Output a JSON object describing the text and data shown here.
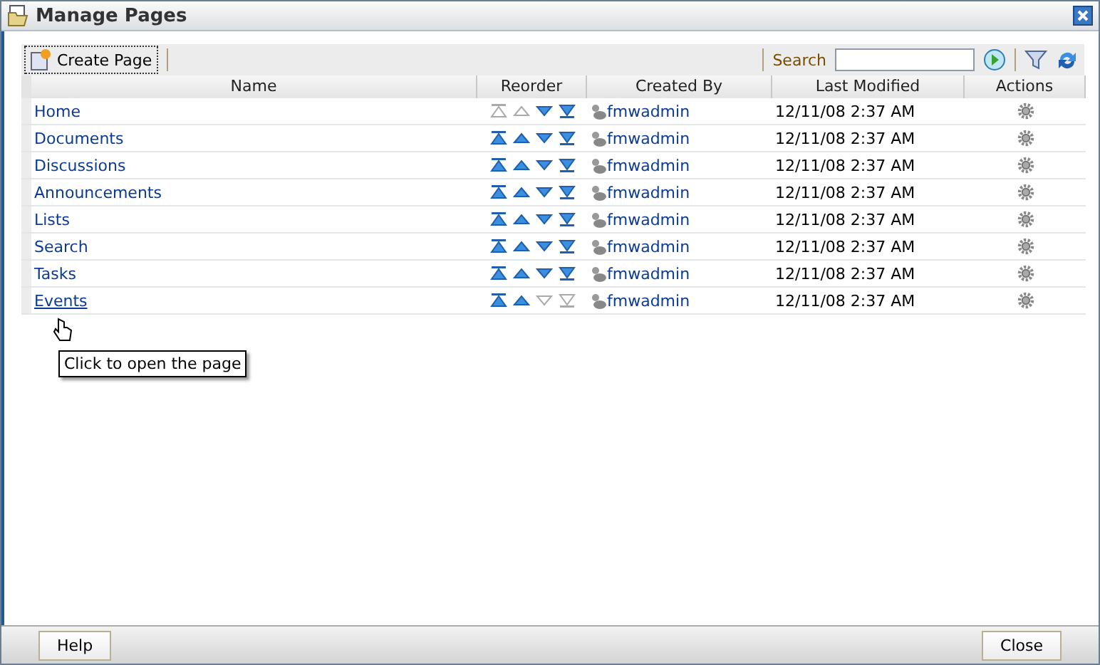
{
  "window": {
    "title": "Manage Pages"
  },
  "toolbar": {
    "create_button": "Create Page",
    "search_label": "Search"
  },
  "table": {
    "columns": [
      "Name",
      "Reorder",
      "Created By",
      "Last Modified",
      "Actions"
    ],
    "rows": [
      {
        "name": "Home",
        "can_move_up": false,
        "can_move_down": true,
        "created_by": "fmwadmin",
        "modified": "12/11/08 2:37 AM",
        "hovered": false
      },
      {
        "name": "Documents",
        "can_move_up": true,
        "can_move_down": true,
        "created_by": "fmwadmin",
        "modified": "12/11/08 2:37 AM",
        "hovered": false
      },
      {
        "name": "Discussions",
        "can_move_up": true,
        "can_move_down": true,
        "created_by": "fmwadmin",
        "modified": "12/11/08 2:37 AM",
        "hovered": false
      },
      {
        "name": "Announcements",
        "can_move_up": true,
        "can_move_down": true,
        "created_by": "fmwadmin",
        "modified": "12/11/08 2:37 AM",
        "hovered": false
      },
      {
        "name": "Lists",
        "can_move_up": true,
        "can_move_down": true,
        "created_by": "fmwadmin",
        "modified": "12/11/08 2:37 AM",
        "hovered": false
      },
      {
        "name": "Search",
        "can_move_up": true,
        "can_move_down": true,
        "created_by": "fmwadmin",
        "modified": "12/11/08 2:37 AM",
        "hovered": false
      },
      {
        "name": "Tasks",
        "can_move_up": true,
        "can_move_down": true,
        "created_by": "fmwadmin",
        "modified": "12/11/08 2:37 AM",
        "hovered": false
      },
      {
        "name": "Events",
        "can_move_up": true,
        "can_move_down": false,
        "created_by": "fmwadmin",
        "modified": "12/11/08 2:37 AM",
        "hovered": true
      }
    ]
  },
  "tooltip": "Click to open the page",
  "footer": {
    "help_button": "Help",
    "close_button": "Close"
  }
}
